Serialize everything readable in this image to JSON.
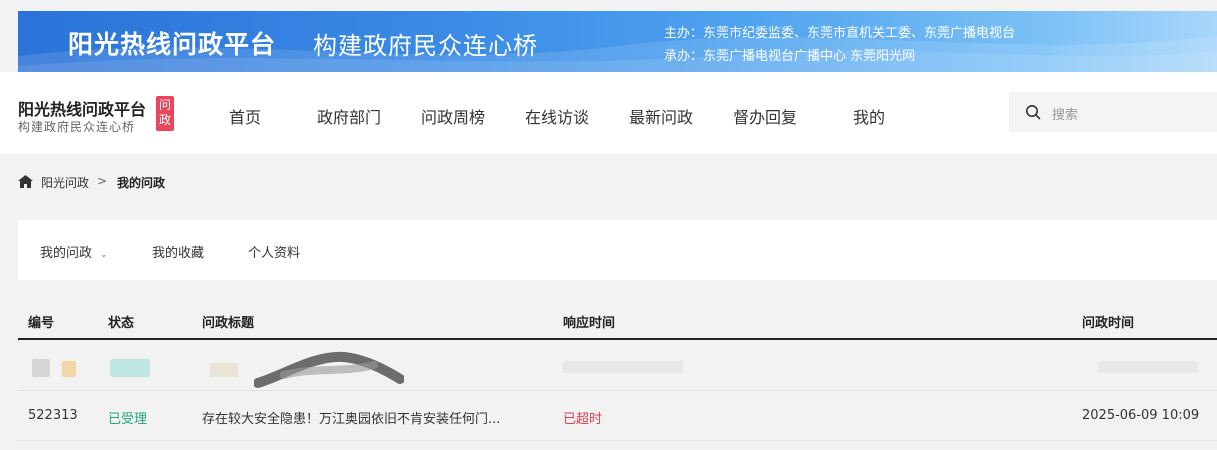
{
  "banner": {
    "title": "阳光热线问政平台",
    "slogan": "构建政府民众连心桥",
    "host": "主办：东莞市纪委监委、东莞市直机关工委、东莞广播电视台",
    "organizer": "承办：东莞广播电视台广播中心 东莞阳光网"
  },
  "logo": {
    "title": "阳光热线问政平台",
    "subtitle": "构建政府民众连心桥",
    "badge": "问政"
  },
  "nav": [
    "首页",
    "政府部门",
    "问政周榜",
    "在线访谈",
    "最新问政",
    "督办回复",
    "我的"
  ],
  "search": {
    "placeholder": "搜索"
  },
  "breadcrumb": {
    "root": "阳光问政",
    "separator": ">",
    "current": "我的问政"
  },
  "tabs": [
    "我的问政",
    "我的收藏",
    "个人资料"
  ],
  "table": {
    "headers": [
      "编号",
      "状态",
      "问政标题",
      "响应时间",
      "问政时间"
    ],
    "rows": [
      {
        "id": "522313",
        "status": "已受理",
        "title": "存在较大安全隐患！万江奥园依旧不肯安装任何门...",
        "response": "已超时",
        "time": "2025-06-09 10:09"
      }
    ]
  },
  "colors": {
    "accent_green": "#22a87a",
    "overdue_red": "#e0404a",
    "badge_red": "#e9465b",
    "banner_blue": "#2a72d8"
  }
}
